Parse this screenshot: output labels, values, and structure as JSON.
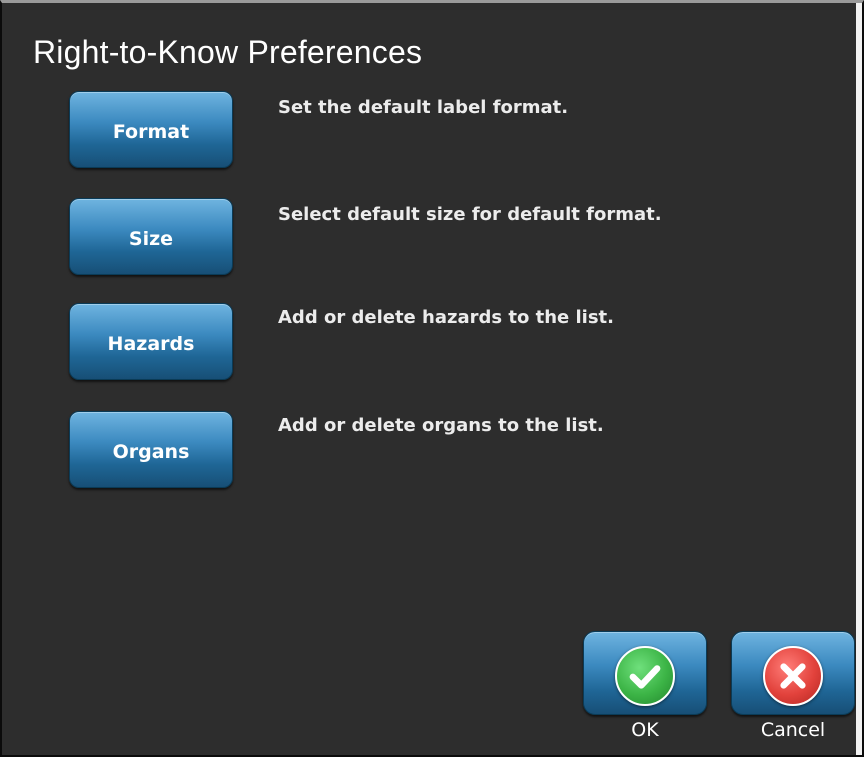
{
  "window": {
    "title": "Right-to-Know Preferences"
  },
  "preferences": [
    {
      "button_label": "Format",
      "description": "Set the default label format."
    },
    {
      "button_label": "Size",
      "description": "Select default size for default format."
    },
    {
      "button_label": "Hazards",
      "description": "Add or delete hazards to the list."
    },
    {
      "button_label": "Organs",
      "description": "Add or delete organs to the list."
    }
  ],
  "actions": {
    "ok": {
      "label": "OK",
      "icon": "checkmark-icon",
      "color": "#3cb446"
    },
    "cancel": {
      "label": "Cancel",
      "icon": "x-icon",
      "color": "#e2423c"
    }
  },
  "colors": {
    "background": "#2d2d2d",
    "button_blue": "#2a77ab",
    "text": "#ffffff"
  }
}
